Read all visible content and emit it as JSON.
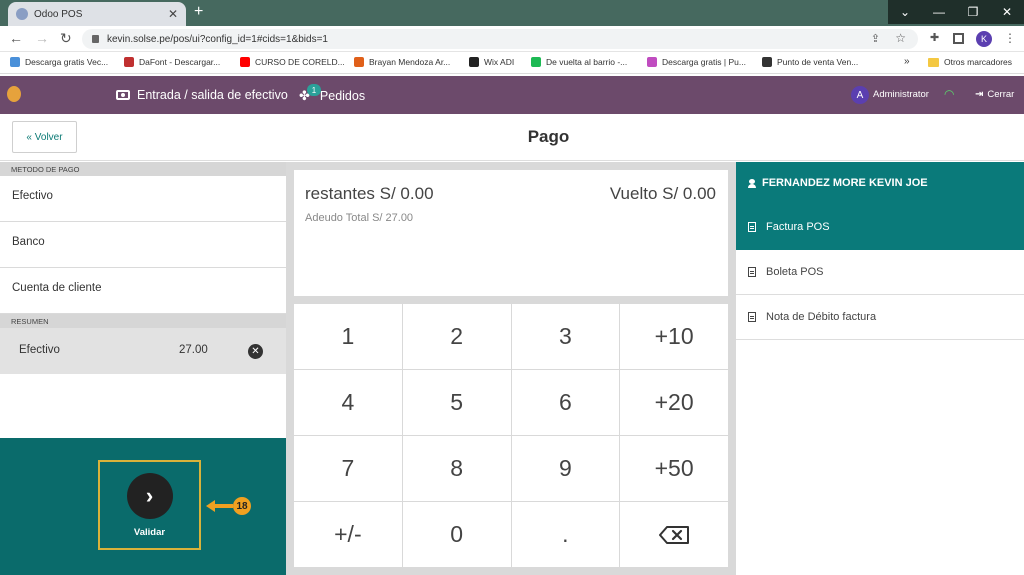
{
  "browser": {
    "tab_title": "Odoo POS",
    "url": "kevin.solse.pe/pos/ui?config_id=1#cids=1&bids=1",
    "profile_initial": "K",
    "bookmarks": [
      {
        "label": "Descarga gratis Vec...",
        "color": "#4a90d9"
      },
      {
        "label": "DaFont - Descargar...",
        "color": "#c03030"
      },
      {
        "label": "CURSO DE CORELD...",
        "color": "#ff0000"
      },
      {
        "label": "Brayan Mendoza Ar...",
        "color": "#e0601a"
      },
      {
        "label": "Wix ADI",
        "color": "#222222"
      },
      {
        "label": "De vuelta al barrio -...",
        "color": "#1db954"
      },
      {
        "label": "Descarga gratis | Pu...",
        "color": "#c04cc0"
      },
      {
        "label": "Punto de venta Ven...",
        "color": "#333333"
      }
    ],
    "bookmarks_more": "»",
    "other_bookmarks": "Otros marcadores"
  },
  "pos_header": {
    "cash_label": "Entrada / salida de efectivo",
    "orders_label": "Pedidos",
    "orders_count": "1",
    "user_initial": "A",
    "user_name": "Administrator",
    "close_label": "Cerrar"
  },
  "payment": {
    "back_label": "« Volver",
    "title": "Pago",
    "methods_header": "METODO DE PAGO",
    "methods": [
      "Efectivo",
      "Banco",
      "Cuenta de cliente"
    ],
    "summary_header": "RESUMEN",
    "summary_lines": [
      {
        "name": "Efectivo",
        "amount": "27.00"
      }
    ],
    "remaining_text": "restantes S/ 0.00",
    "change_text": "Vuelto S/ 0.00",
    "total_due_text": "Adeudo Total  S/ 27.00",
    "validate_label": "Validar",
    "step_number": "18",
    "numpad": [
      "1",
      "2",
      "3",
      "+10",
      "4",
      "5",
      "6",
      "+20",
      "7",
      "8",
      "9",
      "+50",
      "+/-",
      "0",
      "."
    ]
  },
  "customer": {
    "name": "FERNANDEZ MORE KEVIN JOE",
    "journals": [
      {
        "label": "Factura POS",
        "selected": true
      },
      {
        "label": "Boleta POS",
        "selected": false
      },
      {
        "label": "Nota de Débito factura",
        "selected": false
      }
    ]
  },
  "colors": {
    "header_purple": "#6c4a6b",
    "teal": "#0a7a7a",
    "highlight": "#d9b23a"
  }
}
